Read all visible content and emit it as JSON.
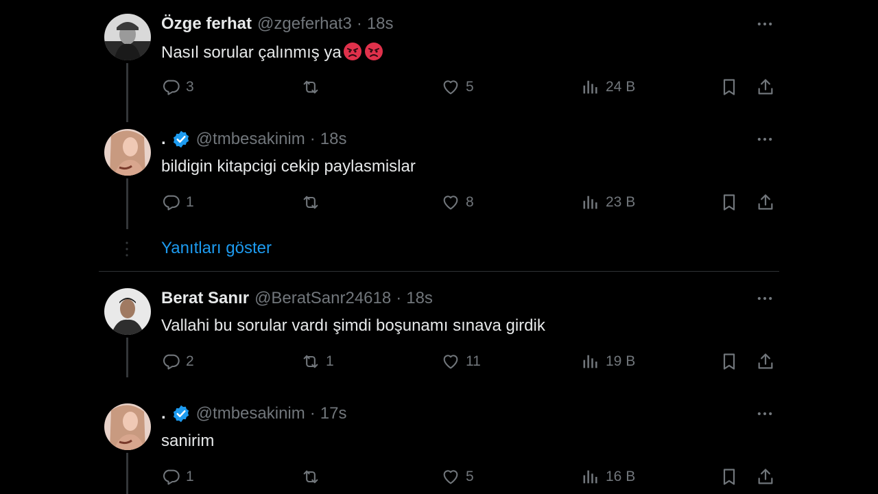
{
  "colors": {
    "background": "#000000",
    "text": "#e7e9ea",
    "muted": "#71767b",
    "accent": "#1d9bf0",
    "verified": "#1d9bf0"
  },
  "tweets": [
    {
      "name": "Özge ferhat",
      "handle": "@zgeferhat3",
      "dot": "·",
      "time": "18s",
      "text": "Nasıl sorular çalınmış ya",
      "emojis": [
        "angry-face-icon",
        "angry-face-icon"
      ],
      "verified": false,
      "replies": "3",
      "retweets": "",
      "likes": "5",
      "views": "24 B"
    },
    {
      "name": ".",
      "handle": "@tmbesakinim",
      "dot": "·",
      "time": "18s",
      "text": "bildigin kitapcigi cekip paylasmislar",
      "verified": true,
      "replies": "1",
      "retweets": "",
      "likes": "8",
      "views": "23 B"
    },
    {
      "name": "Berat Sanır",
      "handle": "@BeratSanr24618",
      "dot": "·",
      "time": "18s",
      "text": "Vallahi bu sorular vardı şimdi boşunamı sınava girdik",
      "verified": false,
      "replies": "2",
      "retweets": "1",
      "likes": "11",
      "views": "19 B"
    },
    {
      "name": ".",
      "handle": "@tmbesakinim",
      "dot": "·",
      "time": "17s",
      "text": "sanirim",
      "verified": true,
      "replies": "1",
      "retweets": "",
      "likes": "5",
      "views": "16 B"
    }
  ],
  "show_replies_label": "Yanıtları göster"
}
